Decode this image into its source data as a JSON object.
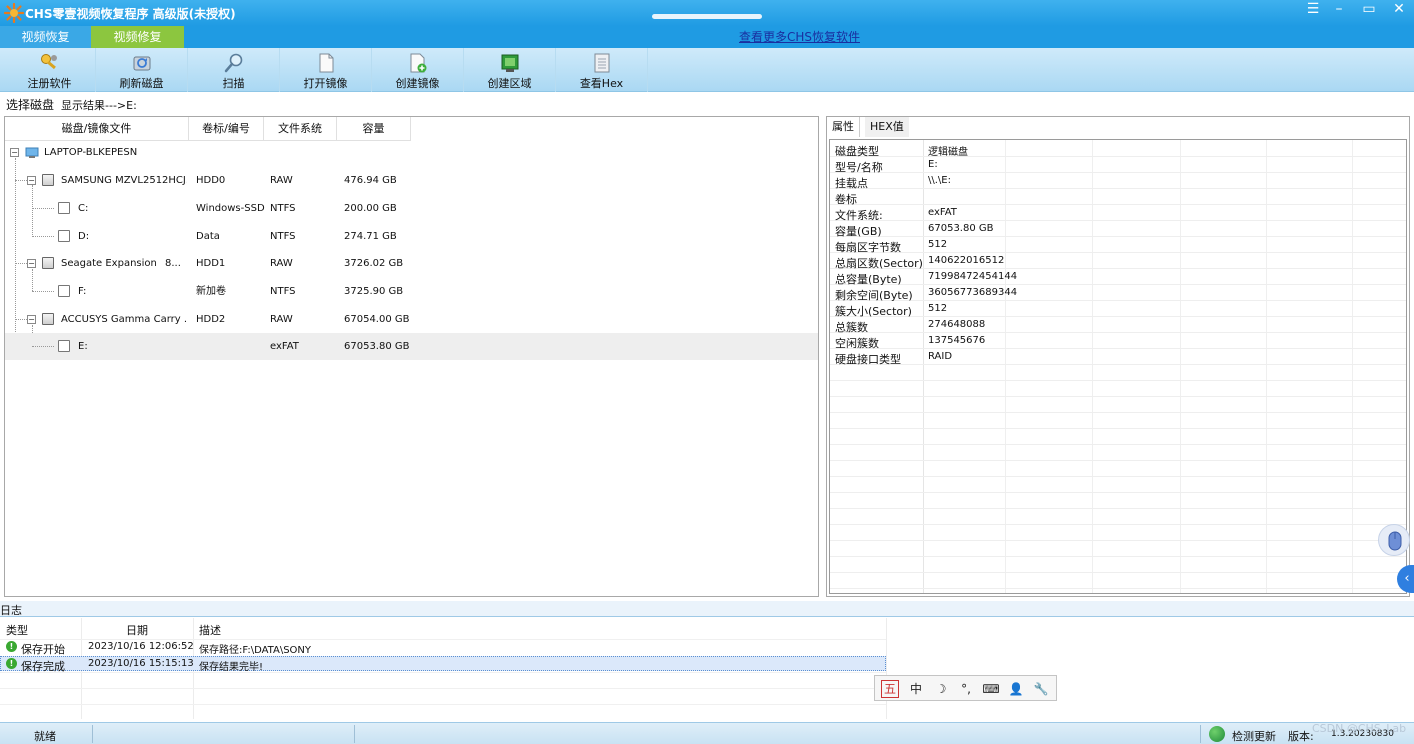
{
  "window": {
    "title": "CHS零壹视频恢复程序 高级版(未授权)",
    "controls": {
      "menu": "☰",
      "minimize": "–",
      "maximize": "▭",
      "close": "✕"
    }
  },
  "tabs": {
    "recover": "视频恢复",
    "repair": "视频修复"
  },
  "more_link": "查看更多CHS恢复软件",
  "toolbar": {
    "items": [
      {
        "label": "注册软件",
        "icon": "key-icon"
      },
      {
        "label": "刷新磁盘",
        "icon": "refresh-disk-icon"
      },
      {
        "label": "扫描",
        "icon": "magnifier-icon"
      },
      {
        "label": "打开镜像",
        "icon": "open-image-icon"
      },
      {
        "label": "创建镜像",
        "icon": "create-image-icon"
      },
      {
        "label": "创建区域",
        "icon": "create-region-icon"
      },
      {
        "label": "查看Hex",
        "icon": "hex-view-icon"
      }
    ]
  },
  "subbar": {
    "select_disk": "选择磁盘",
    "show_result": "显示结果--->E:"
  },
  "disk_table": {
    "columns": [
      "磁盘/镜像文件",
      "卷标/编号",
      "文件系统",
      "容量"
    ],
    "root": "LAPTOP-BLKEPESN",
    "rows": [
      {
        "name": "SAMSUNG MZVL2512HCJ...",
        "label": "HDD0",
        "fs": "RAW",
        "size": "476.94 GB"
      },
      {
        "name": "C:",
        "label": "Windows-SSD",
        "fs": "NTFS",
        "size": "200.00 GB"
      },
      {
        "name": "D:",
        "label": "Data",
        "fs": "NTFS",
        "size": "274.71 GB"
      },
      {
        "name": "Seagate Expansion",
        "extra": "8...",
        "label": "HDD1",
        "fs": "RAW",
        "size": "3726.02 GB"
      },
      {
        "name": "F:",
        "label": "新加卷",
        "fs": "NTFS",
        "size": "3725.90 GB"
      },
      {
        "name": "ACCUSYS Gamma Carry ...",
        "label": "HDD2",
        "fs": "RAW",
        "size": "67054.00 GB"
      },
      {
        "name": "E:",
        "label": "",
        "fs": "exFAT",
        "size": "67053.80 GB"
      }
    ]
  },
  "props": {
    "tabs": [
      "属性",
      "HEX值"
    ],
    "rows": [
      {
        "k": "磁盘类型",
        "v": "逻辑磁盘"
      },
      {
        "k": "型号/名称",
        "v": "E:"
      },
      {
        "k": "挂载点",
        "v": "\\\\.\\E:"
      },
      {
        "k": "卷标",
        "v": ""
      },
      {
        "k": "文件系统:",
        "v": "exFAT"
      },
      {
        "k": "容量(GB)",
        "v": "67053.80 GB"
      },
      {
        "k": "每扇区字节数",
        "v": "512"
      },
      {
        "k": "总扇区数(Sector)",
        "v": "140622016512"
      },
      {
        "k": "总容量(Byte)",
        "v": "71998472454144"
      },
      {
        "k": "剩余空间(Byte)",
        "v": "36056773689344"
      },
      {
        "k": "簇大小(Sector)",
        "v": "512"
      },
      {
        "k": "总簇数",
        "v": "274648088"
      },
      {
        "k": "空闲簇数",
        "v": "137545676"
      },
      {
        "k": "硬盘接口类型",
        "v": "RAID"
      }
    ]
  },
  "log": {
    "title": "日志",
    "columns": [
      "类型",
      "日期",
      "描述"
    ],
    "rows": [
      {
        "type": "保存开始",
        "date": "2023/10/16 12:06:52",
        "desc": "保存路径:F:\\DATA\\SONY"
      },
      {
        "type": "保存完成",
        "date": "2023/10/16 15:15:13",
        "desc": "保存结果完毕!"
      }
    ]
  },
  "ime": {
    "items": [
      "五",
      "中",
      "☽",
      "°,",
      "⌨",
      "👤",
      "🔧"
    ]
  },
  "status": {
    "ready": "就绪",
    "update": "检测更新",
    "version_label": "版本:",
    "version": "1.3.20230830"
  },
  "watermark": "CSDN @CHS_Lab",
  "colors": {
    "titlebar": "#1f9be3",
    "repair_tab": "#8cc63f",
    "link": "#1a2fa0"
  }
}
